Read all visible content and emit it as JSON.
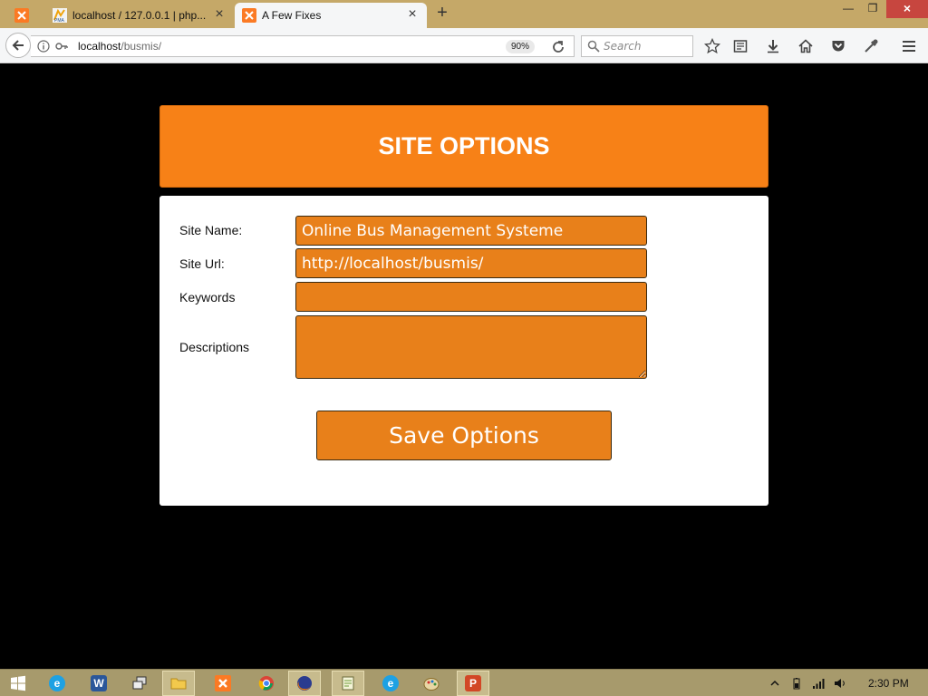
{
  "browser": {
    "tabs": [
      {
        "label": "",
        "icon": "xampp-icon"
      },
      {
        "label": "localhost / 127.0.0.1 | php...",
        "icon": "phpmyadmin-icon"
      },
      {
        "label": "A Few Fixes",
        "icon": "xampp-icon",
        "active": true
      }
    ],
    "url_host": "localhost",
    "url_path": "/busmis/",
    "zoom": "90%",
    "search_placeholder": "Search"
  },
  "page": {
    "title": "SITE OPTIONS",
    "fields": {
      "site_name": {
        "label": "Site Name:",
        "value": "Online Bus Management Systeme",
        "placeholder": ""
      },
      "site_url": {
        "label": "Site Url:",
        "value": "http://localhost/busmis/",
        "placeholder": ""
      },
      "keywords": {
        "label": "Keywords",
        "value": "",
        "placeholder": ""
      },
      "descriptions": {
        "label": "Descriptions",
        "value": "",
        "placeholder": ""
      }
    },
    "save_label": "Save Options"
  },
  "colors": {
    "accent": "#f78117",
    "field_bg": "#e8801a",
    "page_bg": "#000000"
  },
  "taskbar": {
    "items": [
      "windows-start-icon",
      "internet-explorer-icon",
      "word-icon",
      "remote-desktop-icon",
      "file-explorer-icon",
      "xampp-icon",
      "chrome-icon",
      "firefox-icon",
      "notepad-icon",
      "edge-icon",
      "paint-icon",
      "powerpoint-icon"
    ],
    "clock": "2:30 PM"
  }
}
